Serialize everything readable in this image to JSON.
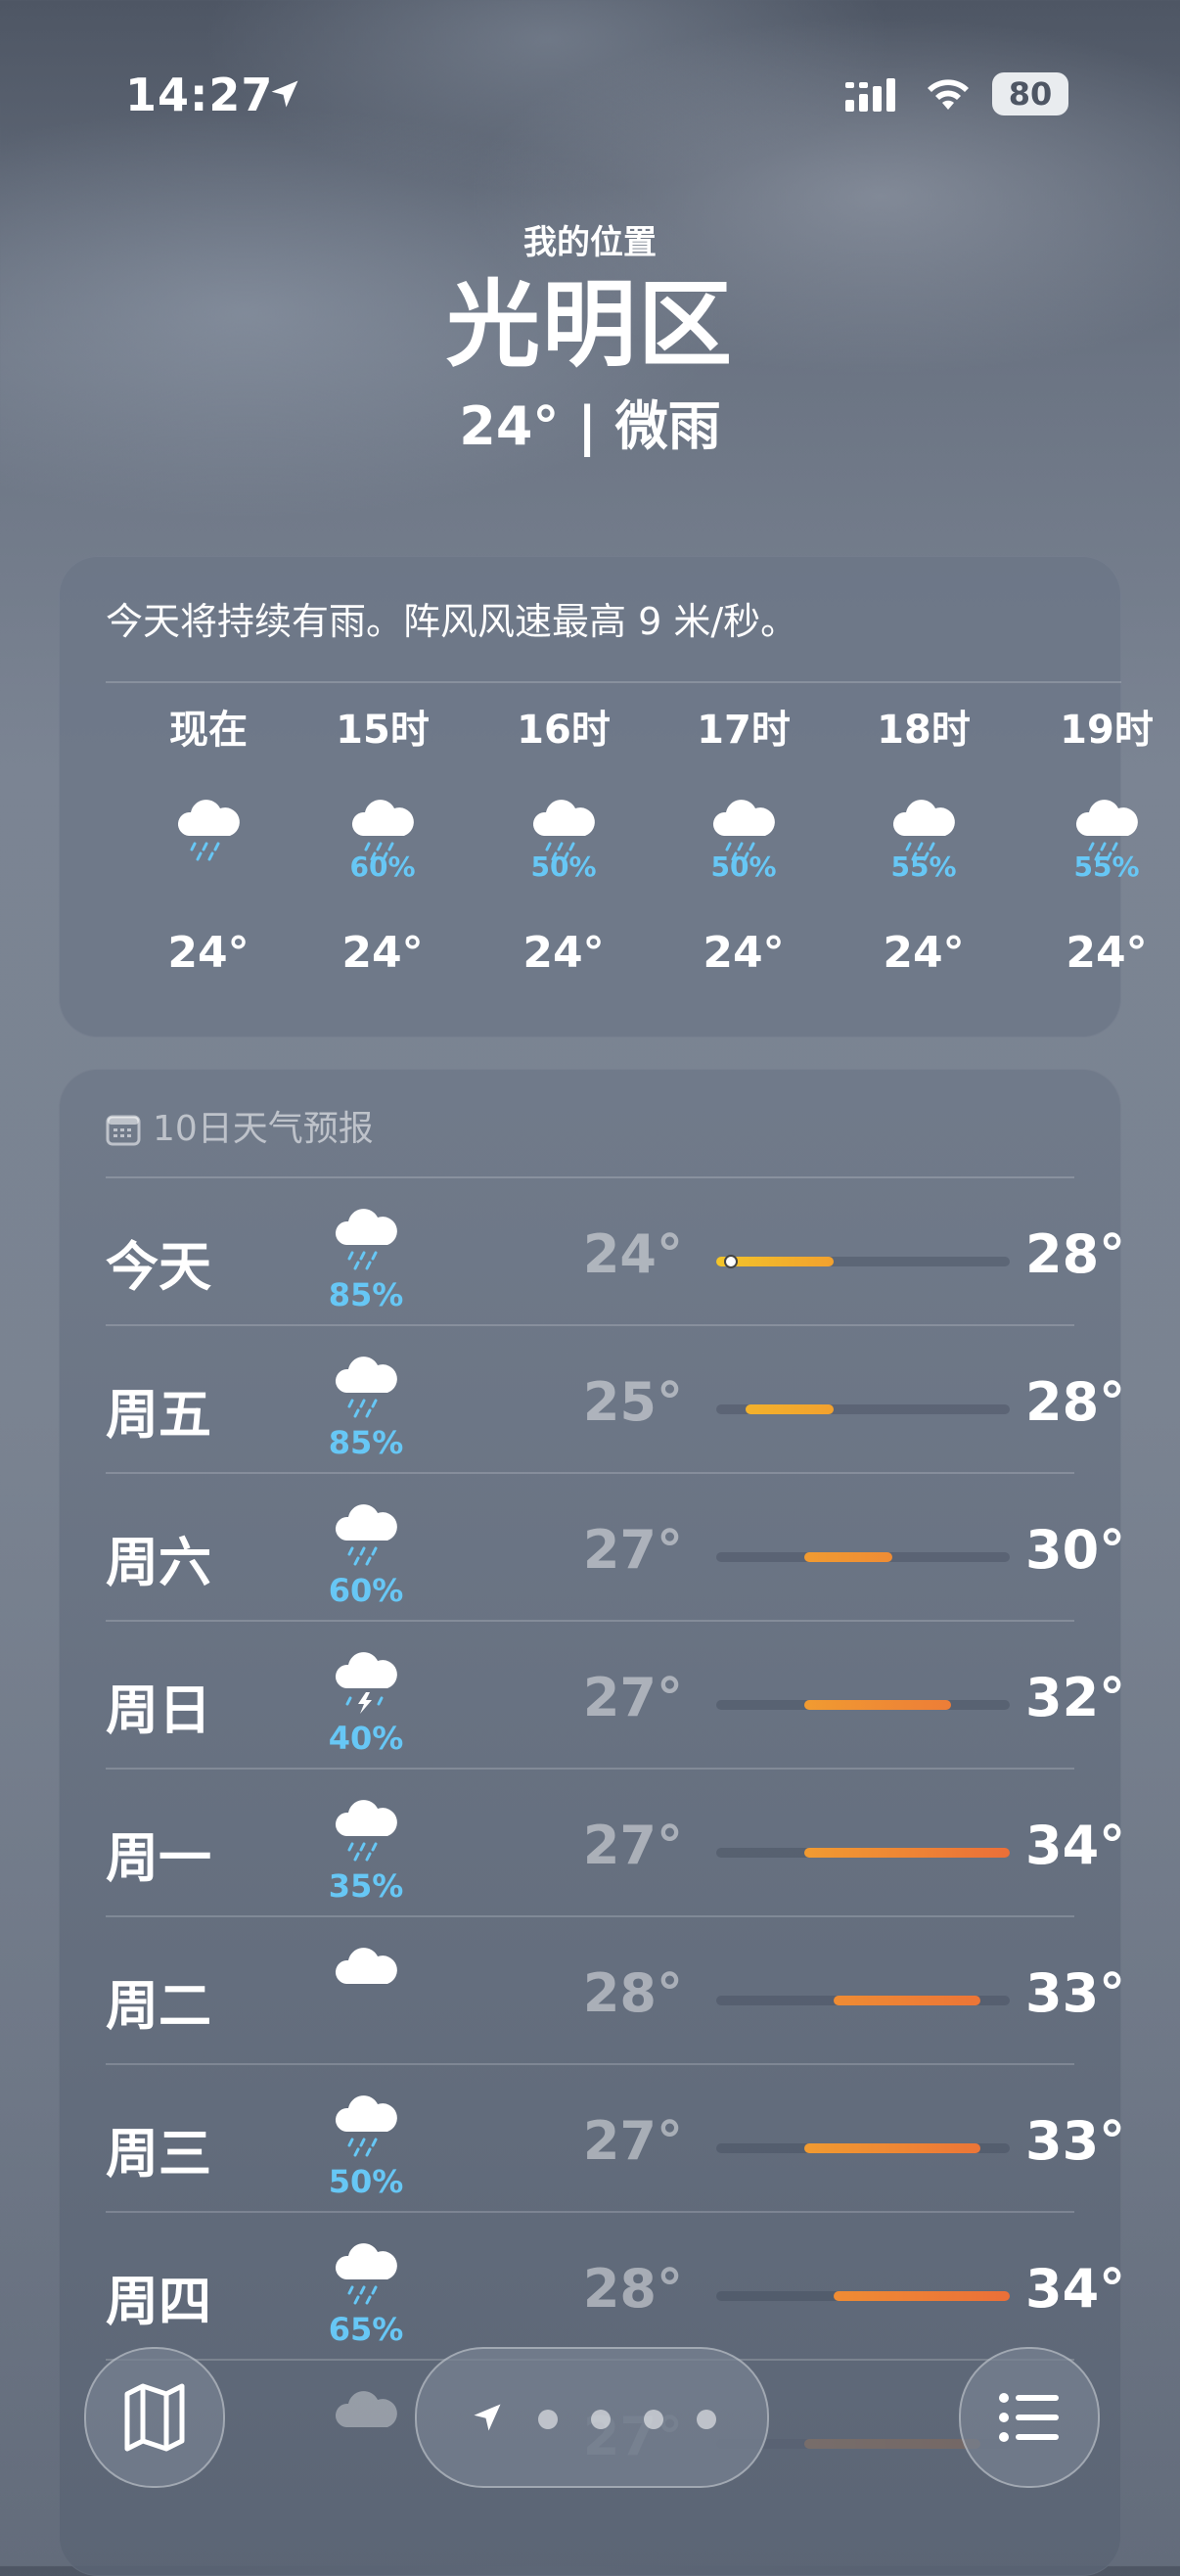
{
  "status_bar": {
    "time": "14:27",
    "battery": "80"
  },
  "header": {
    "location_label": "我的位置",
    "city": "光明区",
    "summary": "24° | 微雨"
  },
  "hourly": {
    "condition_text": "今天将持续有雨。阵风风速最高 9 米/秒。",
    "hours": [
      {
        "time": "现在",
        "icon": "cloud-drizzle-icon",
        "pop": "",
        "temp": "24°"
      },
      {
        "time": "15时",
        "icon": "cloud-rain-icon",
        "pop": "60%",
        "temp": "24°"
      },
      {
        "time": "16时",
        "icon": "cloud-rain-icon",
        "pop": "50%",
        "temp": "24°"
      },
      {
        "time": "17时",
        "icon": "cloud-rain-icon",
        "pop": "50%",
        "temp": "24°"
      },
      {
        "time": "18时",
        "icon": "cloud-rain-icon",
        "pop": "55%",
        "temp": "24°"
      },
      {
        "time": "19时",
        "icon": "cloud-rain-icon",
        "pop": "55%",
        "temp": "24°"
      }
    ]
  },
  "forecast": {
    "title": "10日天气预报",
    "range_min": 24,
    "range_max": 34,
    "days": [
      {
        "day": "今天",
        "icon": "cloud-rain-icon",
        "pop": "85%",
        "low": "24°",
        "high": "28°",
        "low_val": 24,
        "high_val": 28,
        "current_val": 24,
        "color_from": "#f3c52a",
        "color_to": "#f2a12e"
      },
      {
        "day": "周五",
        "icon": "cloud-rain-icon",
        "pop": "85%",
        "low": "25°",
        "high": "28°",
        "low_val": 25,
        "high_val": 28,
        "color_from": "#f3b22c",
        "color_to": "#f2a12e"
      },
      {
        "day": "周六",
        "icon": "cloud-rain-icon",
        "pop": "60%",
        "low": "27°",
        "high": "30°",
        "low_val": 27,
        "high_val": 30,
        "color_from": "#f19b31",
        "color_to": "#ef8c34"
      },
      {
        "day": "周日",
        "icon": "cloud-thunder-icon",
        "pop": "40%",
        "low": "27°",
        "high": "32°",
        "low_val": 27,
        "high_val": 32,
        "color_from": "#f19b31",
        "color_to": "#ed7d37"
      },
      {
        "day": "周一",
        "icon": "cloud-rain-icon",
        "pop": "35%",
        "low": "27°",
        "high": "34°",
        "low_val": 27,
        "high_val": 34,
        "color_from": "#f19b31",
        "color_to": "#eb6f38"
      },
      {
        "day": "周二",
        "icon": "cloud-icon",
        "pop": "",
        "low": "28°",
        "high": "33°",
        "low_val": 28,
        "high_val": 33,
        "color_from": "#ef8c34",
        "color_to": "#ec7537"
      },
      {
        "day": "周三",
        "icon": "cloud-rain-icon",
        "pop": "50%",
        "low": "27°",
        "high": "33°",
        "low_val": 27,
        "high_val": 33,
        "color_from": "#f19b31",
        "color_to": "#ec7537"
      },
      {
        "day": "周四",
        "icon": "cloud-rain-icon",
        "pop": "65%",
        "low": "28°",
        "high": "34°",
        "low_val": 28,
        "high_val": 34,
        "color_from": "#ef8c34",
        "color_to": "#eb6f38"
      },
      {
        "day": "",
        "icon": "cloud-icon",
        "pop": "",
        "low": "27°",
        "high": "",
        "low_val": 27,
        "high_val": 33,
        "color_from": "#a87a55",
        "color_to": "#a06a45"
      }
    ]
  },
  "toolbar": {
    "map_icon": "map-icon",
    "list_icon": "list-icon",
    "page_count": 4
  }
}
